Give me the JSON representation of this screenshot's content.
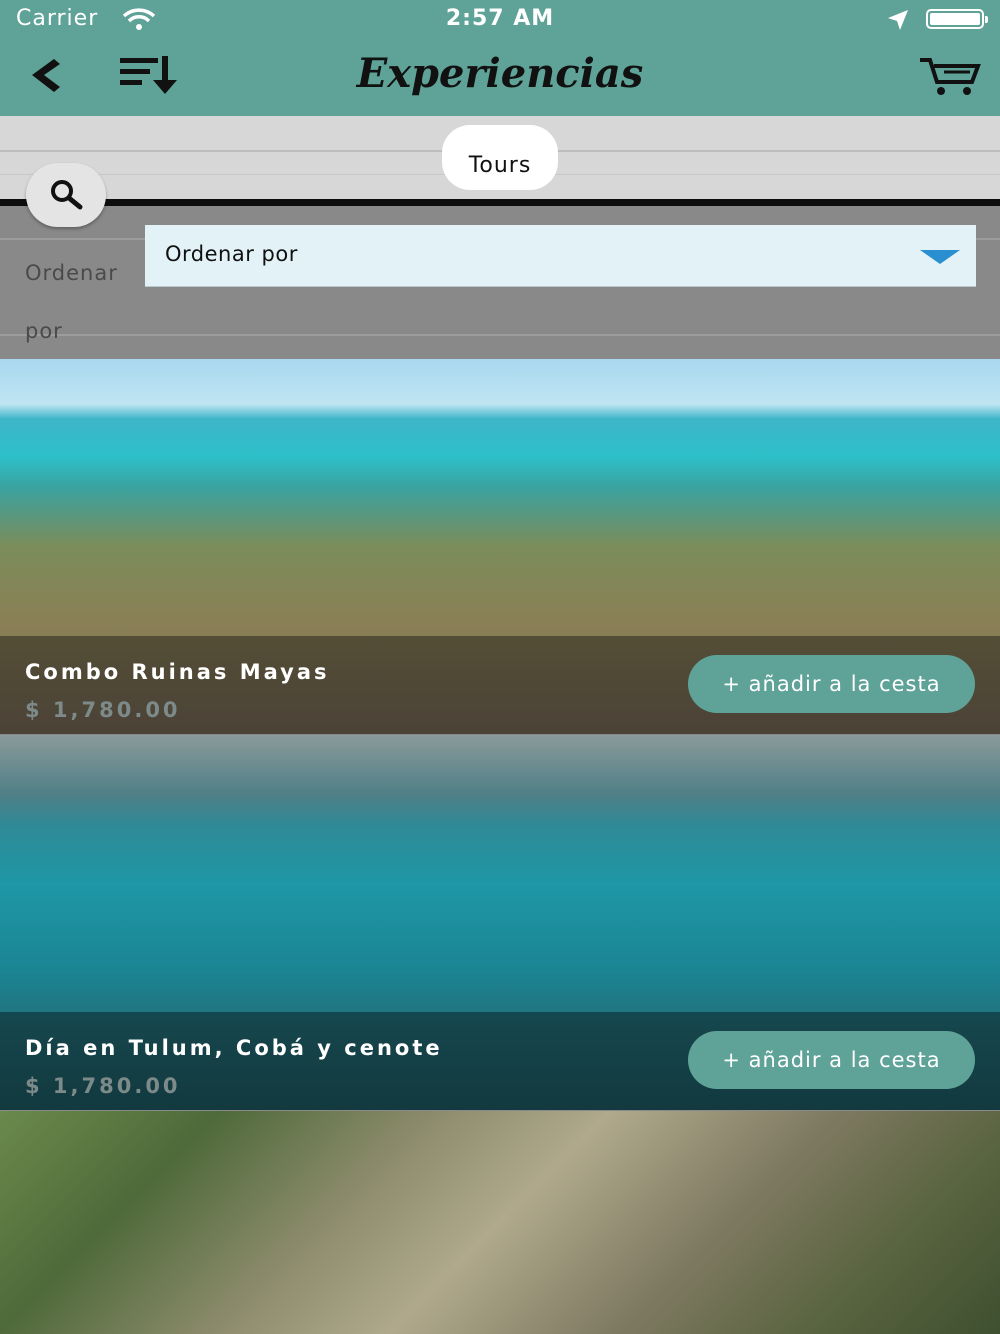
{
  "status_bar": {
    "carrier": "Carrier",
    "time": "2:57 AM"
  },
  "header": {
    "title": "Experiencias"
  },
  "icons": {
    "back": "back-arrow-icon",
    "sort": "sort-descending-icon",
    "cart": "shopping-cart-icon",
    "search": "search-icon",
    "wifi": "wifi-icon",
    "location": "location-arrow-icon",
    "battery": "battery-icon",
    "dropdown": "chevron-down-icon"
  },
  "tabs": [
    {
      "label": "Tours",
      "selected": true
    }
  ],
  "sort": {
    "label": "Ordenar por",
    "placeholder": "Ordenar por"
  },
  "items": [
    {
      "name": "Combo Ruinas Mayas",
      "price": "$ 1,780.00",
      "button": "+ añadir a la cesta"
    },
    {
      "name": "Día en Tulum, Cobá y cenote",
      "price": "$ 1,780.00",
      "button": "+ añadir a la cesta"
    }
  ],
  "colors": {
    "accent": "#5fa398",
    "dropdown_bg": "#e2f2f7",
    "caret": "#2a8fd0"
  }
}
